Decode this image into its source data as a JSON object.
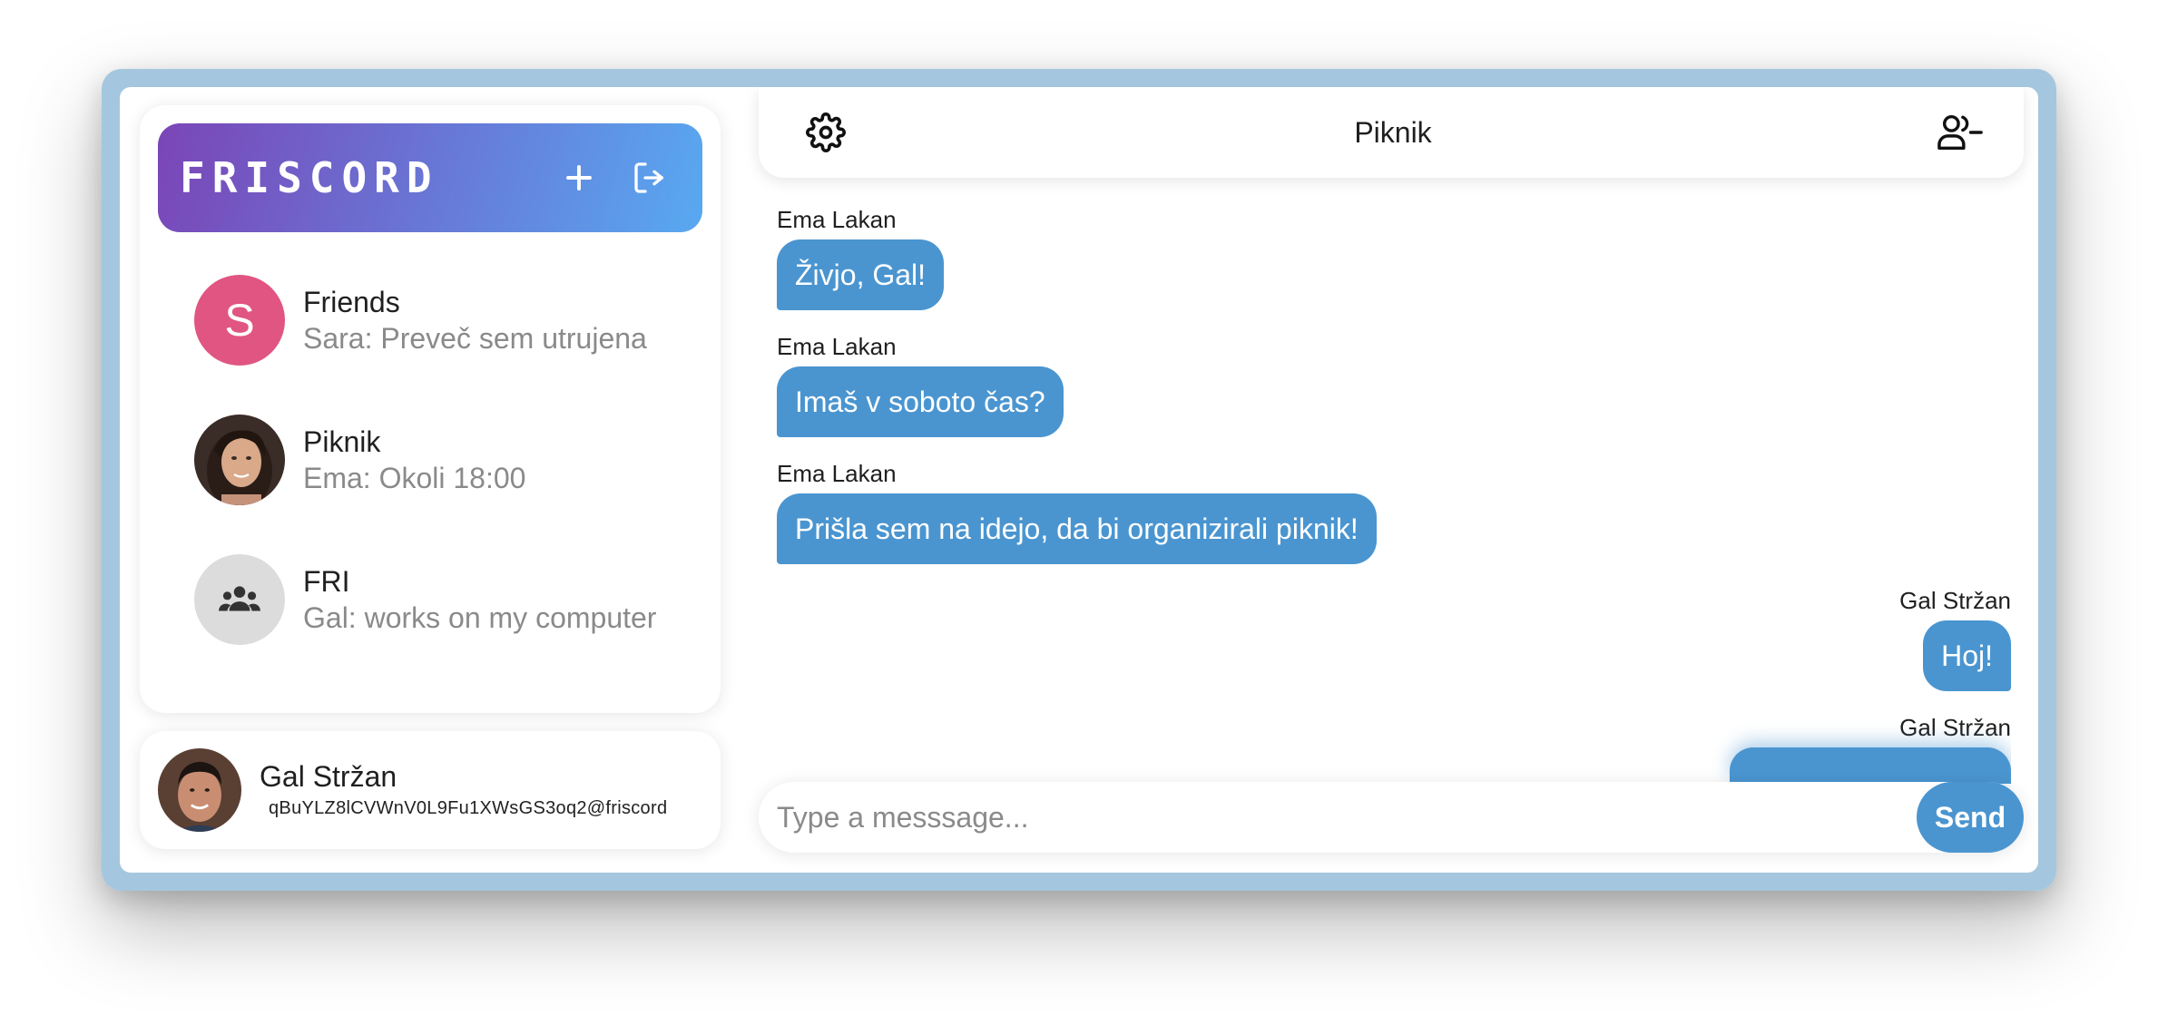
{
  "app": {
    "brand": "FRISCORD",
    "add_icon": "plus-icon",
    "logout_icon": "logout-icon",
    "accent_color": "#4a95d0"
  },
  "sidebar": {
    "chats": [
      {
        "name": "Friends",
        "last_message": "Sara: Preveč sem utrujena",
        "avatar_letter": "S",
        "avatar_color": "#e05582"
      },
      {
        "name": "Piknik",
        "last_message": "Ema: Okoli 18:00",
        "avatar": "photo-woman"
      },
      {
        "name": "FRI",
        "last_message": "Gal: works on my computer",
        "avatar": "group-icon"
      }
    ]
  },
  "profile": {
    "name": "Gal Stržan",
    "id": "qBuYLZ8lCVWnV0L9Fu1XWsGS3oq2@friscord"
  },
  "chat": {
    "title": "Piknik",
    "settings_icon": "gear-icon",
    "leave_icon": "user-minus-icon",
    "messages": [
      {
        "sender": "Ema Lakan",
        "text": "Živjo, Gal!",
        "side": "left"
      },
      {
        "sender": "Ema Lakan",
        "text": "Imaš v soboto čas?",
        "side": "left"
      },
      {
        "sender": "Ema Lakan",
        "text": "Prišla sem na idejo, da bi organizirali piknik!",
        "side": "left"
      },
      {
        "sender": "Gal Stržan",
        "text": "Hoj!",
        "side": "right"
      },
      {
        "sender": "Gal Stržan",
        "text": "",
        "side": "right"
      }
    ]
  },
  "composer": {
    "placeholder": "Type a messsage...",
    "value": "",
    "send_label": "Send"
  }
}
